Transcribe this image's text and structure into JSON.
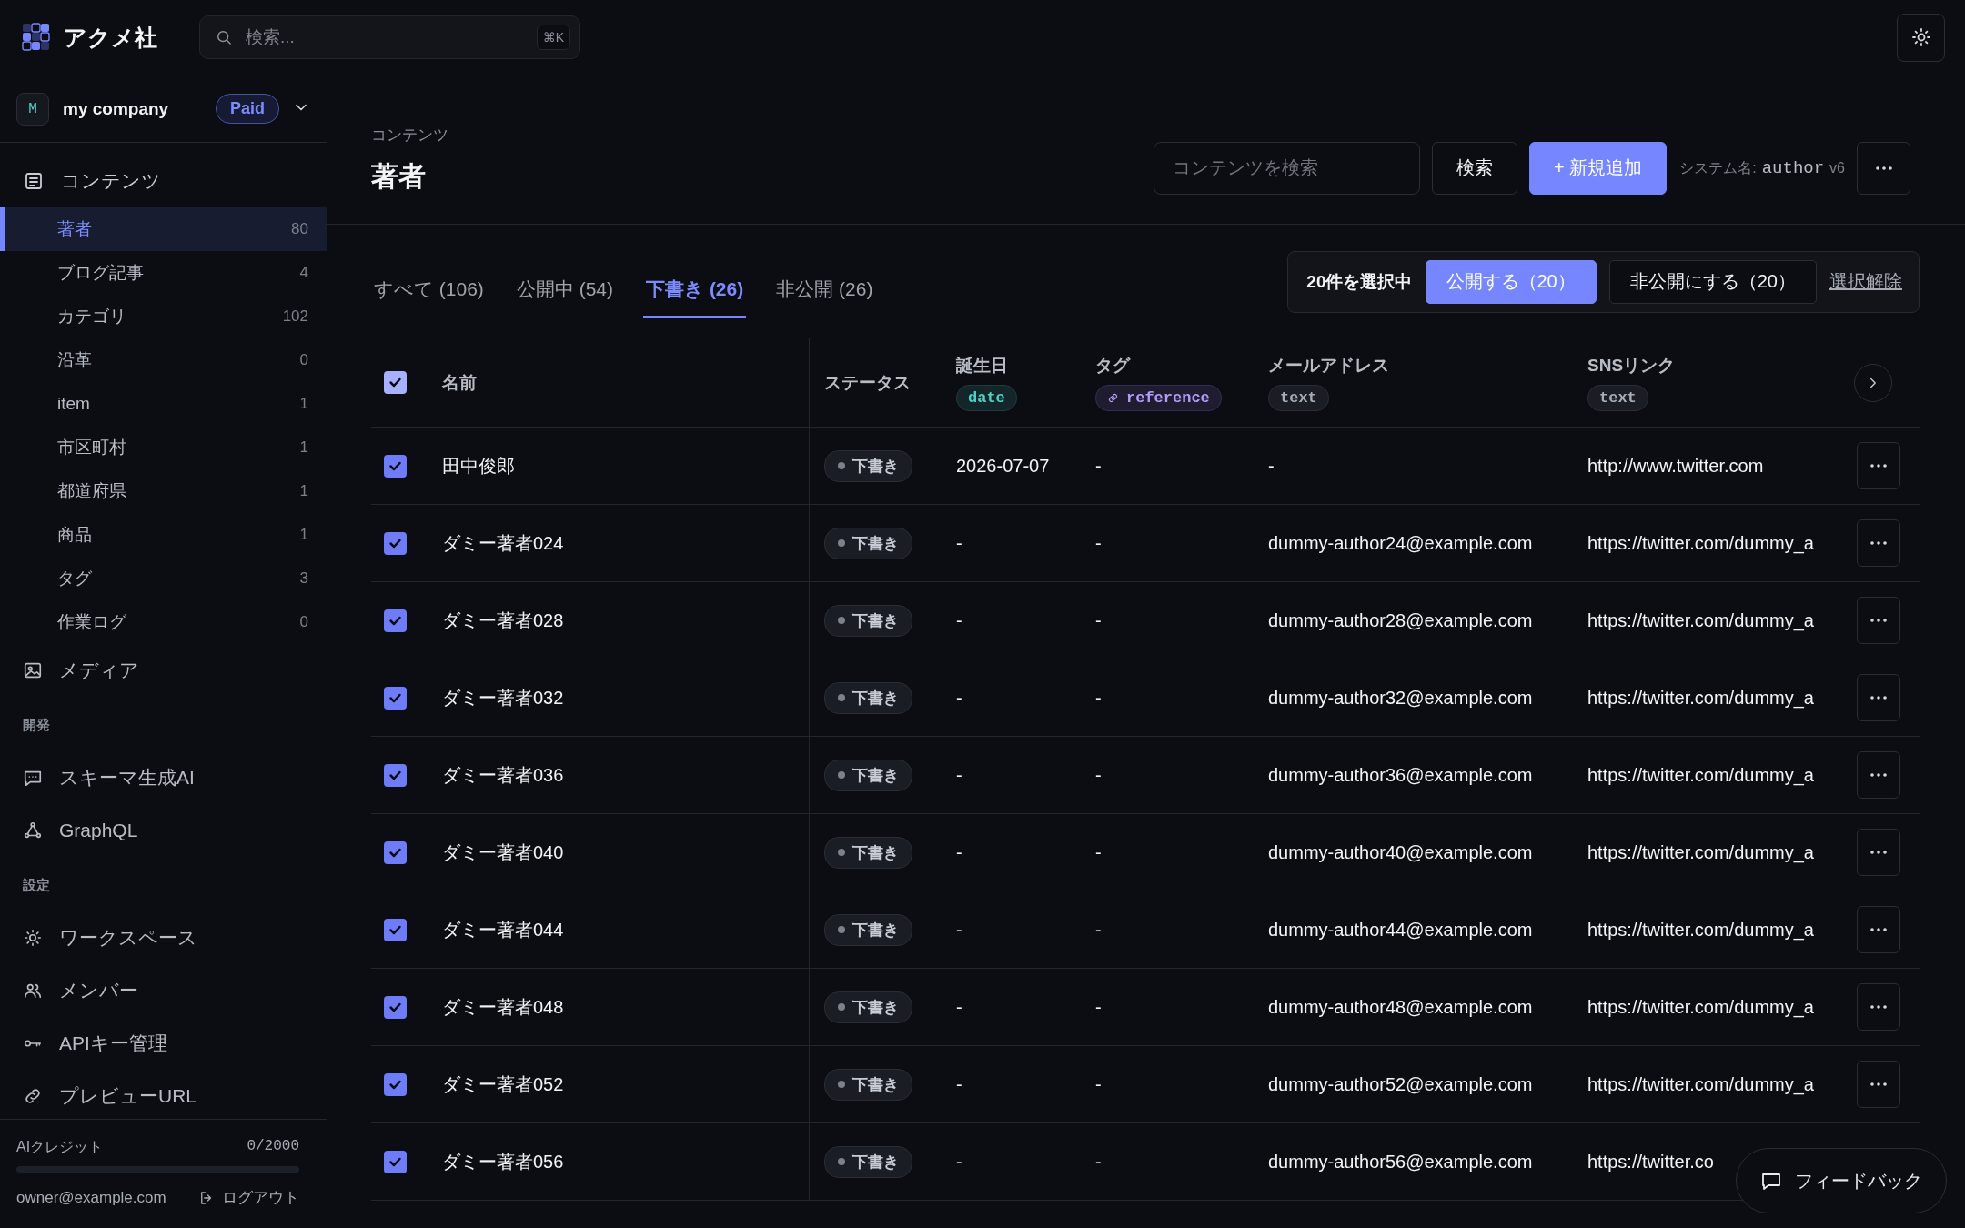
{
  "header": {
    "brand": "アクメ社",
    "search": {
      "placeholder": "検索...",
      "shortcut": "⌘K"
    }
  },
  "workspace": {
    "avatar": "M",
    "name": "my company",
    "plan": "Paid"
  },
  "sidebar": {
    "content_label": "コンテンツ",
    "models": [
      {
        "label": "著者",
        "count": "80",
        "selected": true
      },
      {
        "label": "ブログ記事",
        "count": "4",
        "selected": false
      },
      {
        "label": "カテゴリ",
        "count": "102",
        "selected": false
      },
      {
        "label": "沿革",
        "count": "0",
        "selected": false
      },
      {
        "label": "item",
        "count": "1",
        "selected": false
      },
      {
        "label": "市区町村",
        "count": "1",
        "selected": false
      },
      {
        "label": "都道府県",
        "count": "1",
        "selected": false
      },
      {
        "label": "商品",
        "count": "1",
        "selected": false
      },
      {
        "label": "タグ",
        "count": "3",
        "selected": false
      },
      {
        "label": "作業ログ",
        "count": "0",
        "selected": false
      }
    ],
    "nav": [
      {
        "kind": "item",
        "label": "メディア"
      },
      {
        "kind": "heading",
        "label": "開発"
      },
      {
        "kind": "item",
        "label": "スキーマ生成AI"
      },
      {
        "kind": "item",
        "label": "GraphQL"
      },
      {
        "kind": "heading",
        "label": "設定"
      },
      {
        "kind": "item",
        "label": "ワークスペース"
      },
      {
        "kind": "item",
        "label": "メンバー"
      },
      {
        "kind": "item",
        "label": "APIキー管理"
      },
      {
        "kind": "item",
        "label": "プレビューURL"
      }
    ],
    "footer": {
      "credits_label": "AIクレジット",
      "credits": "0/2000",
      "email": "owner@example.com",
      "logout": "ログアウト"
    }
  },
  "page": {
    "breadcrumb": "コンテンツ",
    "title": "著者",
    "search": {
      "placeholder": "コンテンツを検索"
    },
    "search_button": "検索",
    "add_button": "+ 新規追加",
    "system_label": "システム名:",
    "system_name": "author",
    "version": "v6"
  },
  "tabs": [
    {
      "label": "すべて (106)",
      "selected": false
    },
    {
      "label": "公開中 (54)",
      "selected": false
    },
    {
      "label": "下書き (26)",
      "selected": true
    },
    {
      "label": "非公開 (26)",
      "selected": false
    }
  ],
  "bulk": {
    "count_text": "20件を選択中",
    "publish": "公開する（20）",
    "unpublish": "非公開にする（20）",
    "clear": "選択解除"
  },
  "table": {
    "all_checked": true,
    "columns": [
      {
        "label": "名前"
      },
      {
        "label": "ステータス"
      },
      {
        "label": "誕生日",
        "chip": {
          "label": "date",
          "kind": "date"
        }
      },
      {
        "label": "タグ",
        "chip": {
          "label": "reference",
          "kind": "reference"
        }
      },
      {
        "label": "メールアドレス",
        "chip": {
          "label": "text",
          "kind": "text"
        }
      },
      {
        "label": "SNSリンク",
        "chip": {
          "label": "text",
          "kind": "text"
        }
      }
    ],
    "rows": [
      {
        "checked": true,
        "name": "田中俊郎",
        "status": "下書き",
        "birthday": "2026-07-07",
        "tag": "-",
        "email": "-",
        "sns": "http://www.twitter.com",
        "has_menu": true
      },
      {
        "checked": true,
        "name": "ダミー著者024",
        "status": "下書き",
        "birthday": "-",
        "tag": "-",
        "email": "dummy-author24@example.com",
        "sns": "https://twitter.com/dummy_a",
        "has_menu": true
      },
      {
        "checked": true,
        "name": "ダミー著者028",
        "status": "下書き",
        "birthday": "-",
        "tag": "-",
        "email": "dummy-author28@example.com",
        "sns": "https://twitter.com/dummy_a",
        "has_menu": true
      },
      {
        "checked": true,
        "name": "ダミー著者032",
        "status": "下書き",
        "birthday": "-",
        "tag": "-",
        "email": "dummy-author32@example.com",
        "sns": "https://twitter.com/dummy_a",
        "has_menu": true
      },
      {
        "checked": true,
        "name": "ダミー著者036",
        "status": "下書き",
        "birthday": "-",
        "tag": "-",
        "email": "dummy-author36@example.com",
        "sns": "https://twitter.com/dummy_a",
        "has_menu": true
      },
      {
        "checked": true,
        "name": "ダミー著者040",
        "status": "下書き",
        "birthday": "-",
        "tag": "-",
        "email": "dummy-author40@example.com",
        "sns": "https://twitter.com/dummy_a",
        "has_menu": true
      },
      {
        "checked": true,
        "name": "ダミー著者044",
        "status": "下書き",
        "birthday": "-",
        "tag": "-",
        "email": "dummy-author44@example.com",
        "sns": "https://twitter.com/dummy_a",
        "has_menu": true
      },
      {
        "checked": true,
        "name": "ダミー著者048",
        "status": "下書き",
        "birthday": "-",
        "tag": "-",
        "email": "dummy-author48@example.com",
        "sns": "https://twitter.com/dummy_a",
        "has_menu": true
      },
      {
        "checked": true,
        "name": "ダミー著者052",
        "status": "下書き",
        "birthday": "-",
        "tag": "-",
        "email": "dummy-author52@example.com",
        "sns": "https://twitter.com/dummy_a",
        "has_menu": true
      },
      {
        "checked": true,
        "name": "ダミー著者056",
        "status": "下書き",
        "birthday": "-",
        "tag": "-",
        "email": "dummy-author56@example.com",
        "sns": "https://twitter.co",
        "has_menu": false
      }
    ]
  },
  "feedback": {
    "label": "フィードバック"
  }
}
